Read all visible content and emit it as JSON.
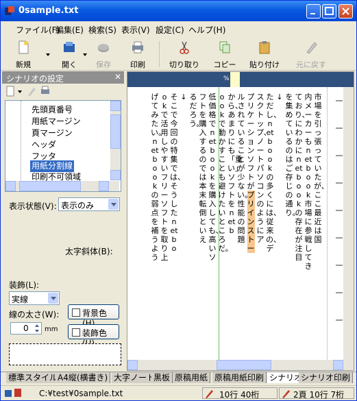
{
  "window": {
    "title": "0sample.txt"
  },
  "menu": [
    "ファイル(F)",
    "編集(E)",
    "検索(S)",
    "表示(V)",
    "設定(C)",
    "ヘルプ(H)"
  ],
  "toolbar": {
    "new": "新規",
    "open": "開く",
    "save": "保存",
    "print": "印刷",
    "cut": "切り取り",
    "copy": "コピー",
    "paste": "貼り付け",
    "undo": "元に戻す"
  },
  "panel": {
    "title": "シナリオの設定",
    "tree": [
      "先頭頁番号",
      "用紙マージン",
      "頁マージン",
      "ヘッダ",
      "フッタ",
      "用紙分割線",
      "印刷不可領域"
    ],
    "selected_index": 5,
    "display_state_label": "表示状態(V):",
    "display_state_value": "表示のみ",
    "bold_italic_label": "太字斜体(B):",
    "decoration_label": "装飾(L):",
    "decoration_value": "実線",
    "line_width_label": "線の太さ(W):",
    "line_width_value": "0",
    "line_width_unit": "mm",
    "bgcolor_button": "背景色(H)",
    "decocolor_button": "装飾色(U)"
  },
  "editor": {
    "columns": [
      "市場を引っ張っていたが、ここ最近は国",
      "内メーカーもnetbook市場に参戦してき",
      "ており、にわかにnetbookの存在が注目",
      "を集めているのはご存じの通り。",
      "",
      "ただし、netbookの多くには、従来の、デ",
      "スクトップ、ノートパソコンのようにア",
      "プリケーションソフトがプリインストー",
      "ルされていることが少ない。性能の問題",
      "から、あまりにも「重い」ソフトをnetb",
      "ookで動かすことも避けたいところだ。",
      "低価格でnetbookを購入しても、高いソ",
      "フトを購入するのでは本末転倒といえ",
      "るだろう。",
      "",
      "そこで今回の特集では、そうしたnetbo",
      "okで活用しやすいフリーソフトを取り上",
      "げてみたい。netbookの弱点を補うよう"
    ],
    "highlight": "プリインストール",
    "ruler_marker": "%"
  },
  "tabs": [
    "標準スタイル",
    "A4縦(横書き)",
    "大字ノート",
    "黒板",
    "原稿用紙",
    "原稿用紙印刷",
    "シナリオ",
    "シナリオ印刷"
  ],
  "active_tab_index": 6,
  "status": {
    "path": "C:¥test¥0sample.txt",
    "lines": "10行 40桁",
    "page": "2頁 10行 7桁"
  }
}
